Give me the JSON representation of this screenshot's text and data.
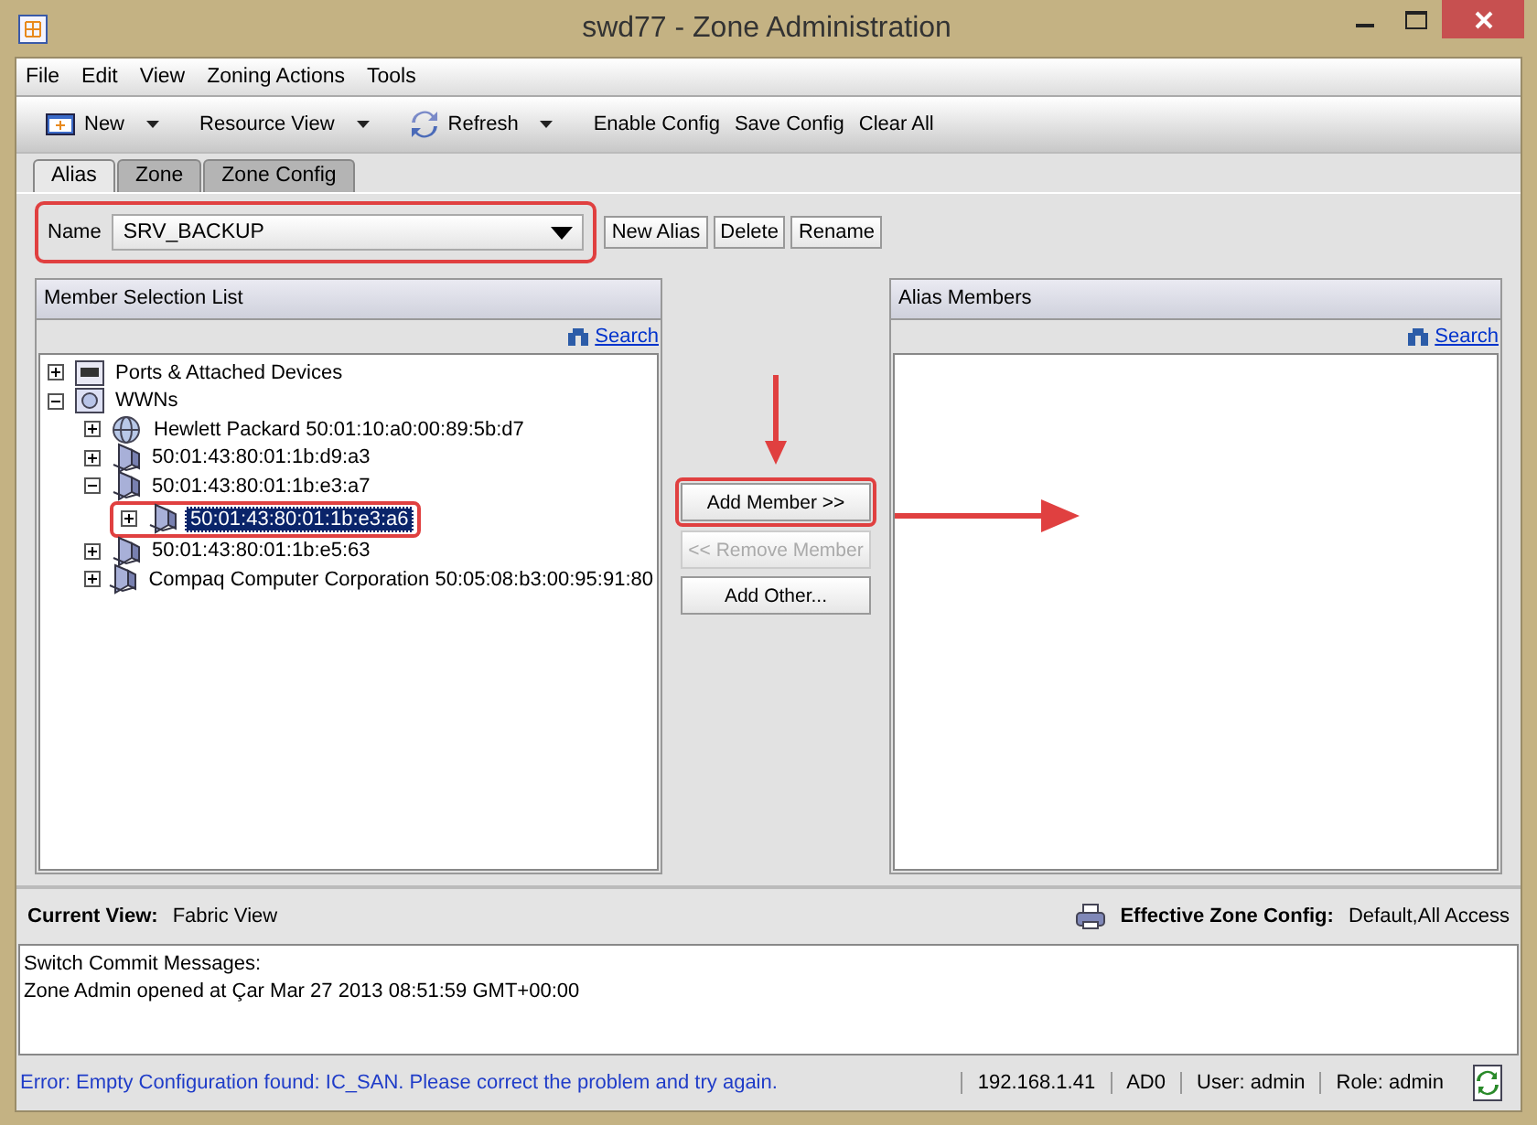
{
  "window": {
    "title": "swd77 - Zone Administration"
  },
  "menu": [
    "File",
    "Edit",
    "View",
    "Zoning Actions",
    "Tools"
  ],
  "toolbar": [
    {
      "label": "New",
      "kind": "dropdown"
    },
    {
      "label": "Resource View",
      "kind": "dropdown"
    },
    {
      "label": "Refresh",
      "kind": "dropdown"
    },
    {
      "label": "Enable Config",
      "kind": "plain"
    },
    {
      "label": "Save Config",
      "kind": "plain"
    },
    {
      "label": "Clear All",
      "kind": "plain"
    }
  ],
  "tabs": [
    {
      "label": "Alias",
      "selected": true
    },
    {
      "label": "Zone",
      "selected": false
    },
    {
      "label": "Zone Config",
      "selected": false
    }
  ],
  "alias": {
    "label": "Name",
    "value": "SRV_BACKUP",
    "buttons": [
      "New Alias",
      "Delete",
      "Rename"
    ]
  },
  "member_panel": {
    "title": "Member Selection List",
    "search": "Search",
    "tree": [
      {
        "label": "Ports & Attached Devices",
        "kind": "ports",
        "expanded": false,
        "selected": false
      },
      {
        "label": "WWNs",
        "kind": "wwns",
        "expanded": true,
        "selected": false,
        "children": [
          {
            "label": "Hewlett Packard 50:01:10:a0:00:89:5b:d7",
            "kind": "globe",
            "expanded": false,
            "selected": false
          },
          {
            "label": "50:01:43:80:01:1b:d9:a3",
            "kind": "device",
            "expanded": false,
            "selected": false
          },
          {
            "label": "50:01:43:80:01:1b:e3:a7",
            "kind": "device",
            "expanded": true,
            "selected": false,
            "children": [
              {
                "label": "50:01:43:80:01:1b:e3:a6",
                "kind": "device",
                "expanded": false,
                "selected": true
              }
            ]
          },
          {
            "label": "50:01:43:80:01:1b:e5:63",
            "kind": "device",
            "expanded": false,
            "selected": false
          },
          {
            "label": "Compaq Computer Corporation 50:05:08:b3:00:95:91:80",
            "kind": "device",
            "expanded": false,
            "selected": false
          }
        ]
      }
    ]
  },
  "actions": [
    {
      "label": "Add Member >>",
      "disabled": false
    },
    {
      "label": "<< Remove Member",
      "disabled": true
    },
    {
      "label": "Add Other...",
      "disabled": false
    }
  ],
  "alias_panel": {
    "title": "Alias Members",
    "search": "Search"
  },
  "view_bar": {
    "current_view_label": "Current View:",
    "current_view": "Fabric View",
    "effective_label": "Effective Zone Config:",
    "effective": "Default,All Access"
  },
  "messages": [
    "Switch Commit Messages:",
    "Zone Admin opened at Çar Mar 27 2013 08:51:59 GMT+00:00"
  ],
  "status_bar": {
    "error": "Error: Empty Configuration found: IC_SAN. Please correct the problem and try again.",
    "fields": [
      "192.168.1.41",
      "AD0",
      "User: admin",
      "Role: admin"
    ]
  }
}
